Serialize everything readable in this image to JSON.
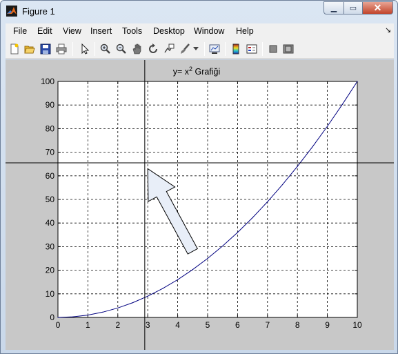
{
  "window": {
    "title": "Figure 1",
    "controls": {
      "minimize": "▁",
      "maximize": "▭",
      "close": "✕"
    }
  },
  "menu": [
    "File",
    "Edit",
    "View",
    "Insert",
    "Tools",
    "Desktop",
    "Window",
    "Help"
  ],
  "toolbar": [
    "new-figure-icon",
    "open-file-icon",
    "save-icon",
    "print-icon",
    "edit-plot-arrow-icon",
    "zoom-in-icon",
    "zoom-out-icon",
    "pan-hand-icon",
    "rotate-3d-icon",
    "data-cursor-icon",
    "brush-icon",
    "link-plot-icon",
    "colorbar-icon",
    "legend-icon",
    "hide-plot-tools-icon",
    "show-plot-tools-icon"
  ],
  "colors": {
    "curve": "#000080",
    "figure_bg": "#c8c8c8",
    "axes_bg": "#ffffff",
    "arrow_fill": "#e8eef8"
  },
  "chart_data": {
    "type": "line",
    "title": "y= x² Grafiği",
    "title_parts": {
      "base": "y= x",
      "exponent": "2",
      "suffix": " Grafiği"
    },
    "xlabel": "",
    "ylabel": "",
    "xlim": [
      0,
      10
    ],
    "ylim": [
      0,
      100
    ],
    "xticks": [
      "0",
      "1",
      "2",
      "3",
      "4",
      "5",
      "6",
      "7",
      "8",
      "9",
      "10"
    ],
    "yticks": [
      "0",
      "10",
      "20",
      "30",
      "40",
      "50",
      "60",
      "70",
      "80",
      "90",
      "100"
    ],
    "grid": true,
    "grid_style": "dashed",
    "series": [
      {
        "color": "#000080",
        "x": [
          0,
          0.5,
          1,
          1.5,
          2,
          2.5,
          3,
          3.5,
          4,
          4.5,
          5,
          5.5,
          6,
          6.5,
          7,
          7.5,
          8,
          8.5,
          9,
          9.5,
          10
        ],
        "y": [
          0,
          0.25,
          1,
          2.25,
          4,
          6.25,
          9,
          12.25,
          16,
          20.25,
          25,
          30.25,
          36,
          42.25,
          49,
          56.25,
          64,
          72.25,
          81,
          90.25,
          100
        ]
      }
    ],
    "crosshair": {
      "x": 2.9,
      "y": 65.5
    },
    "arrow_annotation": {
      "from": [
        4.5,
        28
      ],
      "to": [
        3.0,
        63
      ],
      "label": ""
    }
  }
}
